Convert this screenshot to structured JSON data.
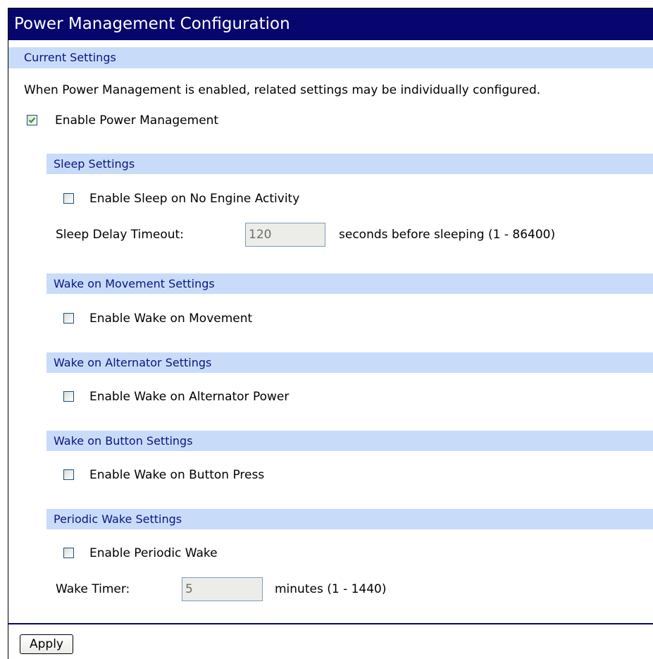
{
  "page": {
    "title": "Power Management Configuration"
  },
  "current_settings": {
    "heading": "Current Settings",
    "description": "When Power Management is enabled, related settings may be individually configured.",
    "enable_pm": {
      "label": "Enable Power Management",
      "checked": true
    }
  },
  "sleep": {
    "heading": "Sleep Settings",
    "enable": {
      "label": "Enable Sleep on No Engine Activity",
      "checked": false
    },
    "timeout_label": "Sleep Delay Timeout:",
    "timeout_value": "120",
    "timeout_hint": "seconds before sleeping (1 - 86400)"
  },
  "wake_movement": {
    "heading": "Wake on Movement Settings",
    "enable": {
      "label": "Enable Wake on Movement",
      "checked": false
    }
  },
  "wake_alternator": {
    "heading": "Wake on Alternator Settings",
    "enable": {
      "label": "Enable Wake on Alternator Power",
      "checked": false
    }
  },
  "wake_button": {
    "heading": "Wake on Button Settings",
    "enable": {
      "label": "Enable Wake on Button Press",
      "checked": false
    }
  },
  "periodic_wake": {
    "heading": "Periodic Wake Settings",
    "enable": {
      "label": "Enable Periodic Wake",
      "checked": false
    },
    "timer_label": "Wake Timer:",
    "timer_value": "5",
    "timer_hint": "minutes (1 - 1440)"
  },
  "actions": {
    "apply_label": "Apply"
  },
  "colors": {
    "title_bg": "#06066e",
    "band_bg": "#c8dcfa",
    "band_text": "#0a1680",
    "check_mark": "#1fa01f"
  }
}
